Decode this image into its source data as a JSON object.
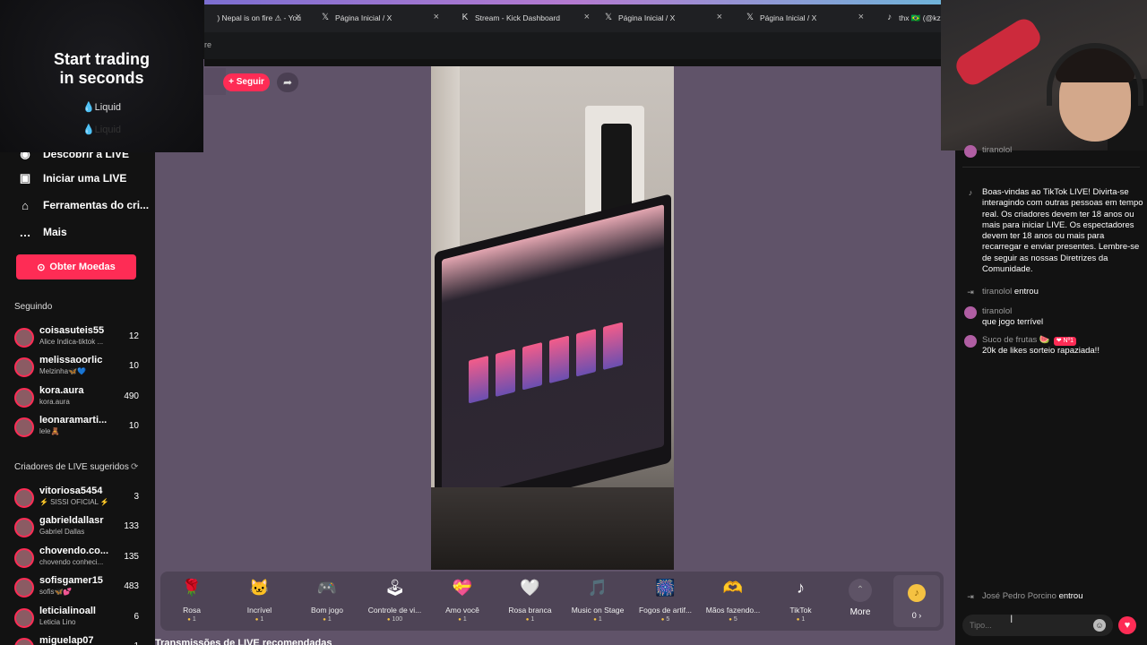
{
  "browser": {
    "tabs": [
      {
        "icon": "youtube-icon",
        "glyph": "",
        "label": ") Nepal is on fire ⚠ - YouTube"
      },
      {
        "icon": "x-icon",
        "glyph": "𝕏",
        "label": "Página Inicial / X"
      },
      {
        "icon": "kick-icon",
        "glyph": "K",
        "label": "Stream - Kick Dashboard"
      },
      {
        "icon": "x-icon",
        "glyph": "𝕏",
        "label": "Página Inicial / X"
      },
      {
        "icon": "x-icon",
        "glyph": "𝕏",
        "label": "Página Inicial / X"
      },
      {
        "icon": "tiktok-icon",
        "glyph": "♪",
        "label": "thx 🇧🇷 (@kzn"
      }
    ],
    "address_fragment": "re",
    "close_glyph": "×"
  },
  "ad": {
    "title_line1": "Start trading",
    "title_line2": "in seconds",
    "brand": "💧Liquid",
    "ghost": "💧Liquid"
  },
  "stream": {
    "follow_label": "+ Seguir",
    "share_glyph": "➦"
  },
  "sidebar": {
    "partial_item": "Descobrir a LIVE",
    "nav": [
      {
        "icon": "video-camera-icon",
        "glyph": "▣",
        "label": "Iniciar uma LIVE"
      },
      {
        "icon": "home-tools-icon",
        "glyph": "⌂",
        "label": "Ferramentas do cri..."
      },
      {
        "icon": "more-dots-icon",
        "glyph": "…",
        "label": "Mais"
      }
    ],
    "coins_button": "Obter Moedas",
    "following_title": "Seguindo",
    "following": [
      {
        "name": "coisasuteis55",
        "sub": "Alice Indica-tiktok ...",
        "count": "12"
      },
      {
        "name": "melissaoorlic",
        "sub": "Melzinha🦋💙",
        "count": "10"
      },
      {
        "name": "kora.aura",
        "sub": "kora.aura",
        "count": "490"
      },
      {
        "name": "leonaramarti...",
        "sub": "lele🧸",
        "count": "10"
      }
    ],
    "suggested_title": "Criadores de LIVE sugeridos",
    "suggested": [
      {
        "name": "vitoriosa5454",
        "sub": "⚡ SISSI OFICIAL ⚡",
        "count": "3"
      },
      {
        "name": "gabrieldallasr",
        "sub": "Gabriel Dallas",
        "count": "133"
      },
      {
        "name": "chovendo.co...",
        "sub": "chovendo conheci...",
        "count": "135"
      },
      {
        "name": "sofisgamer15",
        "sub": "sofis🦋💕",
        "count": "483"
      },
      {
        "name": "leticialinoall",
        "sub": "Leticia Lino",
        "count": "6"
      },
      {
        "name": "miguelap07",
        "sub": "",
        "count": "1"
      }
    ]
  },
  "gifts": [
    {
      "name": "Rosa",
      "price": "1",
      "glyph": "🌹"
    },
    {
      "name": "Incrível",
      "price": "1",
      "glyph": "🐱"
    },
    {
      "name": "Bom jogo",
      "price": "1",
      "glyph": "🎮"
    },
    {
      "name": "Controle de vi...",
      "price": "100",
      "glyph": "🕹"
    },
    {
      "name": "Amo você",
      "price": "1",
      "glyph": "💝"
    },
    {
      "name": "Rosa branca",
      "price": "1",
      "glyph": "🤍"
    },
    {
      "name": "Music on Stage",
      "price": "1",
      "glyph": "🎵"
    },
    {
      "name": "Fogos de artif...",
      "price": "5",
      "glyph": "🎆"
    },
    {
      "name": "Mãos fazendo...",
      "price": "5",
      "glyph": "🫶"
    },
    {
      "name": "TikTok",
      "price": "1",
      "glyph": "♪"
    }
  ],
  "gift_bar": {
    "more_label": "More",
    "more_glyph": "⌃",
    "coin_glyph": "♪",
    "coin_count": "0 ›"
  },
  "bottom_title": "Transmissões de LIVE recomendadas",
  "chat": {
    "partial_top_name": "tiranolol",
    "messages": [
      {
        "type": "system",
        "icon": "tiktok-icon",
        "glyph": "♪",
        "name": "",
        "text": "Boas-vindas ao TikTok LIVE! Divirta-se interagindo com outras pessoas em tempo real. Os criadores devem ter 18 anos ou mais para iniciar LIVE. Os espectadores devem ter 18 anos ou mais para recarregar e enviar presentes. Lembre-se de seguir as nossas Diretrizes da Comunidade."
      },
      {
        "type": "join",
        "icon": "enter-icon",
        "glyph": "⇥",
        "name": "tiranolol",
        "text": "entrou"
      },
      {
        "type": "message",
        "icon": "avatar",
        "glyph": "",
        "name": "tiranolol",
        "text": "que jogo terrível"
      },
      {
        "type": "message",
        "icon": "avatar",
        "glyph": "",
        "name": "Suco de frutas 🍉",
        "badge": "❤ Nº1",
        "text": "20k de likes sorteio rapaziada!!"
      }
    ],
    "last_join": {
      "name": "José Pedro Porcino",
      "text": "entrou"
    },
    "input_placeholder": "Tipo...",
    "emoji_glyph": "☺",
    "heart_glyph": "♥"
  }
}
